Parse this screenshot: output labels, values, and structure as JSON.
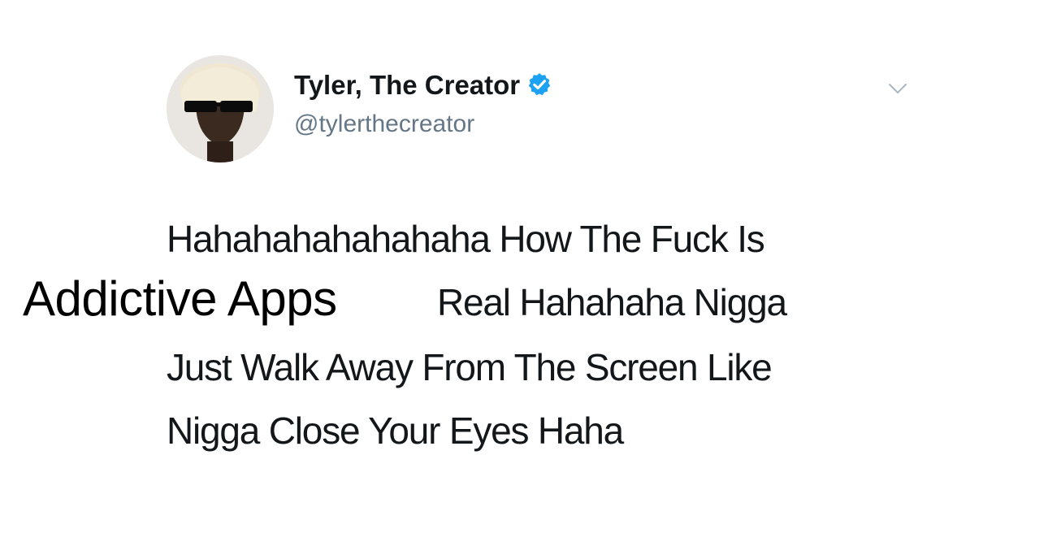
{
  "tweet": {
    "author": {
      "name": "Tyler, The Creator",
      "handle": "@tylerthecreator",
      "verified": true,
      "verified_color": "#1da1f2"
    },
    "text_lines": [
      "Hahahahahahahaha How The Fuck Is",
      "Real Hahahaha Nigga",
      "Just Walk Away From The Screen Like",
      "Nigga Close Your Eyes Haha"
    ],
    "menu_icon": "chevron-down-icon"
  },
  "overlay": {
    "caption": "Addictive Apps"
  },
  "colors": {
    "text": "#14171a",
    "secondary_text": "#657786",
    "background": "#ffffff"
  }
}
